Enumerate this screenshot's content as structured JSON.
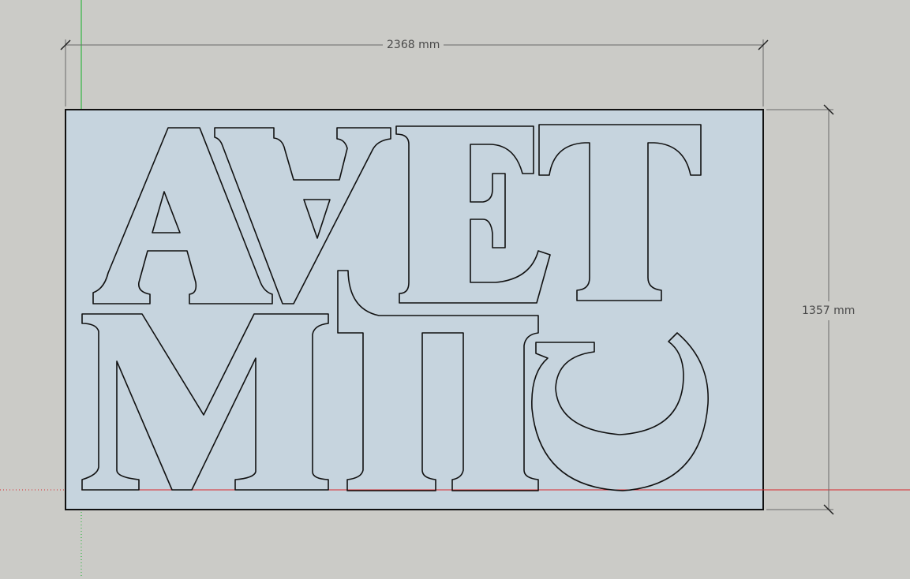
{
  "viewport": {
    "background": "#cbcbc7",
    "panel_fill": "#c6d4de",
    "outline_color": "#111111",
    "axis_red": "#d9262b",
    "axis_green": "#16b12a",
    "dimension_color": "#6a6a6a"
  },
  "dimensions": {
    "width_label": "2368 mm",
    "height_label": "1357 mm"
  }
}
